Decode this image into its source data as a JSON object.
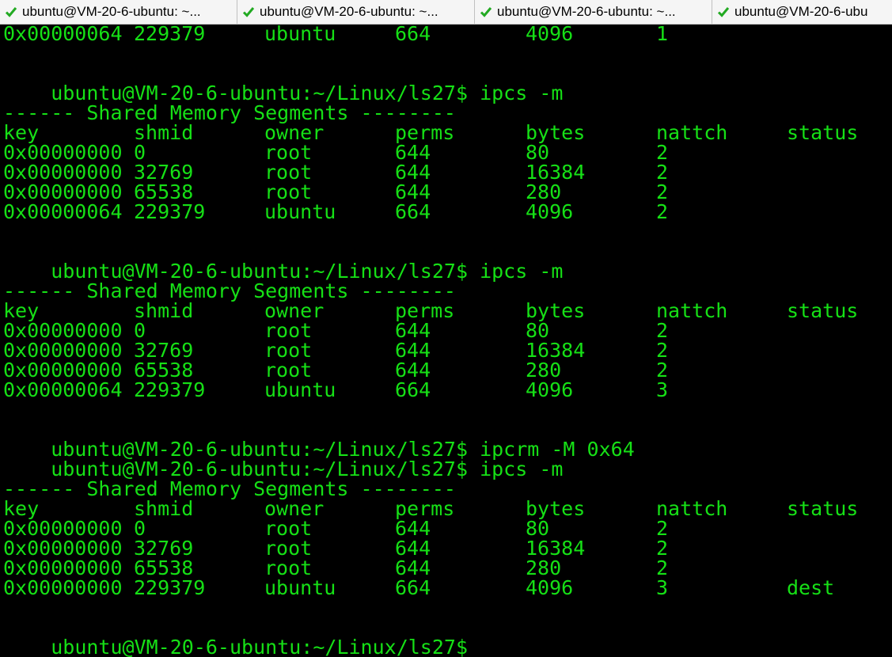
{
  "tabs": [
    {
      "title": "ubuntu@VM-20-6-ubuntu: ~..."
    },
    {
      "title": "ubuntu@VM-20-6-ubuntu: ~..."
    },
    {
      "title": "ubuntu@VM-20-6-ubuntu: ~..."
    },
    {
      "title": "ubuntu@VM-20-6-ubu"
    }
  ],
  "colors": {
    "terminal_text": "#16e016",
    "background": "#000000",
    "tab_check": "#22aa22"
  },
  "prompt": "ubuntu@VM-20-6-ubuntu:~/Linux/ls27$",
  "section_header": "------ Shared Memory Segments --------",
  "columns": [
    "key",
    "shmid",
    "owner",
    "perms",
    "bytes",
    "nattch",
    "status"
  ],
  "top_partial_row": [
    "0x00000064",
    "229379",
    "ubuntu",
    "664",
    "4096",
    "1",
    ""
  ],
  "cmd1": "ipcs -m",
  "block1": [
    [
      "0x00000000",
      "0",
      "root",
      "644",
      "80",
      "2",
      ""
    ],
    [
      "0x00000000",
      "32769",
      "root",
      "644",
      "16384",
      "2",
      ""
    ],
    [
      "0x00000000",
      "65538",
      "root",
      "644",
      "280",
      "2",
      ""
    ],
    [
      "0x00000064",
      "229379",
      "ubuntu",
      "664",
      "4096",
      "2",
      ""
    ]
  ],
  "cmd2": "ipcs -m",
  "block2": [
    [
      "0x00000000",
      "0",
      "root",
      "644",
      "80",
      "2",
      ""
    ],
    [
      "0x00000000",
      "32769",
      "root",
      "644",
      "16384",
      "2",
      ""
    ],
    [
      "0x00000000",
      "65538",
      "root",
      "644",
      "280",
      "2",
      ""
    ],
    [
      "0x00000064",
      "229379",
      "ubuntu",
      "664",
      "4096",
      "3",
      ""
    ]
  ],
  "cmd3": "ipcrm -M 0x64",
  "cmd4": "ipcs -m",
  "block3": [
    [
      "0x00000000",
      "0",
      "root",
      "644",
      "80",
      "2",
      ""
    ],
    [
      "0x00000000",
      "32769",
      "root",
      "644",
      "16384",
      "2",
      ""
    ],
    [
      "0x00000000",
      "65538",
      "root",
      "644",
      "280",
      "2",
      ""
    ],
    [
      "0x00000000",
      "229379",
      "ubuntu",
      "664",
      "4096",
      "3",
      "dest"
    ]
  ]
}
